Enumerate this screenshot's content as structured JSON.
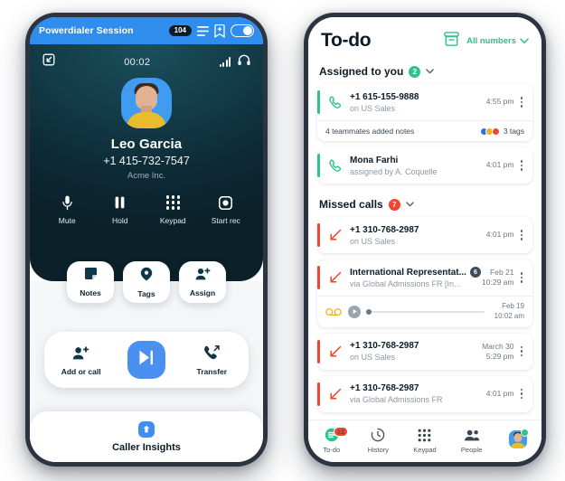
{
  "powerdialer": {
    "topbar": {
      "title": "Powerdialer Session",
      "count": "104",
      "list_icon": "list-icon",
      "bookmark_icon": "bookmark-add-icon",
      "toggle_icon": "toggle-switch"
    },
    "status": {
      "minimize_icon": "minimize-icon",
      "timer": "00:02",
      "signal_icon": "signal-bars-icon",
      "headset_icon": "headset-icon"
    },
    "caller": {
      "avatar": "caller-avatar",
      "name": "Leo Garcia",
      "phone": "+1 415-732-7547",
      "company": "Acme Inc."
    },
    "actions": [
      {
        "label": "Mute",
        "icon": "microphone-icon"
      },
      {
        "label": "Hold",
        "icon": "pause-icon"
      },
      {
        "label": "Keypad",
        "icon": "keypad-icon"
      },
      {
        "label": "Start rec",
        "icon": "record-icon"
      }
    ],
    "cards": [
      {
        "label": "Notes",
        "icon": "note-icon"
      },
      {
        "label": "Tags",
        "icon": "tag-pin-icon"
      },
      {
        "label": "Assign",
        "icon": "person-add-icon"
      }
    ],
    "bar": [
      {
        "label": "Add or call",
        "icon": "person-add-icon"
      },
      {
        "label": "",
        "icon": "play-next-icon"
      },
      {
        "label": "Transfer",
        "icon": "call-transfer-icon"
      }
    ],
    "insights": {
      "label": "Caller Insights",
      "icon": "insights-icon"
    }
  },
  "todo": {
    "header": {
      "title": "To-do",
      "archive_icon": "archive-icon",
      "filter_label": "All numbers",
      "filter_chevron": "chevron-down-icon"
    },
    "sections": [
      {
        "label": "Assigned to you",
        "badge": "2",
        "badge_color": "#2fc28a",
        "chevron": "chevron-down-icon",
        "items": [
          {
            "stripe": "green",
            "icon": "phone-outgoing-icon",
            "title": "+1 615-155-9888",
            "subtitle": "on US Sales",
            "time": "4:55 pm",
            "time2": "",
            "vm_badge": "",
            "notes": {
              "text": "4 teammates added notes",
              "tags_label": "3 tags",
              "tag_colors": [
                "#2f6fe0",
                "#f0b323",
                "#f2442e"
              ]
            },
            "player": null
          },
          {
            "stripe": "green",
            "icon": "phone-outgoing-icon",
            "title": "Mona Farhi",
            "subtitle": "assigned by A. Coquelle",
            "time": "4:01 pm",
            "time2": "",
            "vm_badge": "",
            "notes": null,
            "player": null
          }
        ]
      },
      {
        "label": "Missed calls",
        "badge": "7",
        "badge_color": "#f2442e",
        "chevron": "chevron-down-icon",
        "items": [
          {
            "stripe": "red",
            "icon": "missed-call-icon",
            "title": "+1 310-768-2987",
            "subtitle": "on US Sales",
            "time": "4:01 pm",
            "time2": "",
            "vm_badge": "",
            "notes": null,
            "player": null
          },
          {
            "stripe": "red",
            "icon": "missed-call-icon",
            "title": "International Representat...",
            "subtitle": "via Global Admissions FR [In...",
            "time": "Feb 21",
            "time2": "10:29 am",
            "vm_badge": "6",
            "notes": null,
            "player": {
              "voicemail_icon": "voicemail-icon",
              "play_icon": "play-icon",
              "date": "Feb 19",
              "time": "10:02 am"
            }
          },
          {
            "stripe": "red",
            "icon": "missed-call-icon",
            "title": "+1 310-768-2987",
            "subtitle": "on US Sales",
            "time": "March 30",
            "time2": "5:29 pm",
            "vm_badge": "",
            "notes": null,
            "player": null
          },
          {
            "stripe": "red",
            "icon": "missed-call-icon",
            "title": "+1 310-768-2987",
            "subtitle": "via Global Admissions FR",
            "time": "4:01 pm",
            "time2": "",
            "vm_badge": "",
            "notes": null,
            "player": null
          }
        ]
      }
    ],
    "nav": [
      {
        "label": "To-do",
        "icon": "todo-icon",
        "badge": "12",
        "active": true
      },
      {
        "label": "History",
        "icon": "history-icon",
        "badge": "",
        "active": false
      },
      {
        "label": "Keypad",
        "icon": "keypad-icon",
        "badge": "",
        "active": false
      },
      {
        "label": "People",
        "icon": "people-icon",
        "badge": "",
        "active": false
      },
      {
        "label": "",
        "icon": "profile-avatar",
        "badge": "",
        "active": false
      }
    ]
  }
}
